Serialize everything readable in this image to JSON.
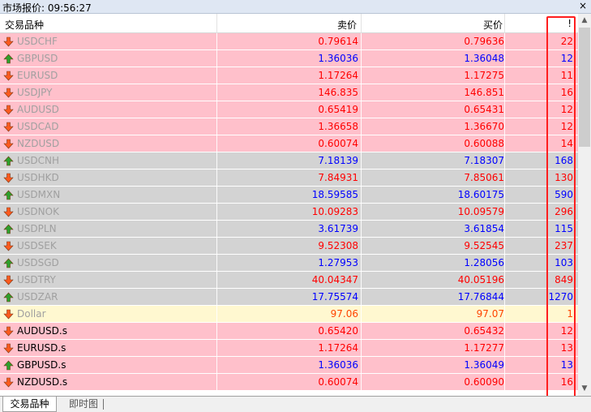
{
  "window": {
    "title": "市场报价: 09:56:27",
    "close_glyph": "×"
  },
  "header": {
    "symbol": "交易品种",
    "bid": "卖价",
    "ask": "买价",
    "spread": "!"
  },
  "rows": [
    {
      "symbol": "USDCHF",
      "bid": "0.79614",
      "ask": "0.79636",
      "spread": "22",
      "dir": "down",
      "bg": "pink",
      "sym_style": "dim",
      "price_color": "red",
      "spread_color": "red"
    },
    {
      "symbol": "GBPUSD",
      "bid": "1.36036",
      "ask": "1.36048",
      "spread": "12",
      "dir": "up",
      "bg": "pink",
      "sym_style": "dim",
      "price_color": "blue",
      "spread_color": "blue"
    },
    {
      "symbol": "EURUSD",
      "bid": "1.17264",
      "ask": "1.17275",
      "spread": "11",
      "dir": "down",
      "bg": "pink",
      "sym_style": "dim",
      "price_color": "red",
      "spread_color": "red"
    },
    {
      "symbol": "USDJPY",
      "bid": "146.835",
      "ask": "146.851",
      "spread": "16",
      "dir": "down",
      "bg": "pink",
      "sym_style": "dim",
      "price_color": "red",
      "spread_color": "red"
    },
    {
      "symbol": "AUDUSD",
      "bid": "0.65419",
      "ask": "0.65431",
      "spread": "12",
      "dir": "down",
      "bg": "pink",
      "sym_style": "dim",
      "price_color": "red",
      "spread_color": "red"
    },
    {
      "symbol": "USDCAD",
      "bid": "1.36658",
      "ask": "1.36670",
      "spread": "12",
      "dir": "down",
      "bg": "pink",
      "sym_style": "dim",
      "price_color": "red",
      "spread_color": "red"
    },
    {
      "symbol": "NZDUSD",
      "bid": "0.60074",
      "ask": "0.60088",
      "spread": "14",
      "dir": "down",
      "bg": "pink",
      "sym_style": "dim",
      "price_color": "red",
      "spread_color": "red"
    },
    {
      "symbol": "USDCNH",
      "bid": "7.18139",
      "ask": "7.18307",
      "spread": "168",
      "dir": "up",
      "bg": "gray",
      "sym_style": "dim",
      "price_color": "blue",
      "spread_color": "blue"
    },
    {
      "symbol": "USDHKD",
      "bid": "7.84931",
      "ask": "7.85061",
      "spread": "130",
      "dir": "down",
      "bg": "gray",
      "sym_style": "dim",
      "price_color": "red",
      "spread_color": "red"
    },
    {
      "symbol": "USDMXN",
      "bid": "18.59585",
      "ask": "18.60175",
      "spread": "590",
      "dir": "up",
      "bg": "gray",
      "sym_style": "dim",
      "price_color": "blue",
      "spread_color": "blue"
    },
    {
      "symbol": "USDNOK",
      "bid": "10.09283",
      "ask": "10.09579",
      "spread": "296",
      "dir": "down",
      "bg": "gray",
      "sym_style": "dim",
      "price_color": "red",
      "spread_color": "red"
    },
    {
      "symbol": "USDPLN",
      "bid": "3.61739",
      "ask": "3.61854",
      "spread": "115",
      "dir": "up",
      "bg": "gray",
      "sym_style": "dim",
      "price_color": "blue",
      "spread_color": "blue"
    },
    {
      "symbol": "USDSEK",
      "bid": "9.52308",
      "ask": "9.52545",
      "spread": "237",
      "dir": "down",
      "bg": "gray",
      "sym_style": "dim",
      "price_color": "red",
      "spread_color": "red"
    },
    {
      "symbol": "USDSGD",
      "bid": "1.27953",
      "ask": "1.28056",
      "spread": "103",
      "dir": "up",
      "bg": "gray",
      "sym_style": "dim",
      "price_color": "blue",
      "spread_color": "blue"
    },
    {
      "symbol": "USDTRY",
      "bid": "40.04347",
      "ask": "40.05196",
      "spread": "849",
      "dir": "down",
      "bg": "gray",
      "sym_style": "dim",
      "price_color": "red",
      "spread_color": "red"
    },
    {
      "symbol": "USDZAR",
      "bid": "17.75574",
      "ask": "17.76844",
      "spread": "1270",
      "dir": "up",
      "bg": "gray",
      "sym_style": "dim",
      "price_color": "blue",
      "spread_color": "blue"
    },
    {
      "symbol": "Dollar",
      "bid": "97.06",
      "ask": "97.07",
      "spread": "1",
      "dir": "down",
      "bg": "yellow",
      "sym_style": "dim",
      "price_color": "orange",
      "spread_color": "orange"
    },
    {
      "symbol": "AUDUSD.s",
      "bid": "0.65420",
      "ask": "0.65432",
      "spread": "12",
      "dir": "down",
      "bg": "pink",
      "sym_style": "blk",
      "price_color": "red",
      "spread_color": "red"
    },
    {
      "symbol": "EURUSD.s",
      "bid": "1.17264",
      "ask": "1.17277",
      "spread": "13",
      "dir": "down",
      "bg": "pink",
      "sym_style": "blk",
      "price_color": "red",
      "spread_color": "red"
    },
    {
      "symbol": "GBPUSD.s",
      "bid": "1.36036",
      "ask": "1.36049",
      "spread": "13",
      "dir": "up",
      "bg": "pink",
      "sym_style": "blk",
      "price_color": "blue",
      "spread_color": "blue"
    },
    {
      "symbol": "NZDUSD.s",
      "bid": "0.60074",
      "ask": "0.60090",
      "spread": "16",
      "dir": "down",
      "bg": "pink",
      "sym_style": "blk",
      "price_color": "red",
      "spread_color": "red"
    }
  ],
  "tabs": {
    "symbols": "交易品种",
    "tick_chart": "即时图"
  },
  "colors": {
    "up_arrow": "#2ca02c",
    "down_arrow": "#ff5a1e",
    "highlight_box": "#ff1e1e"
  }
}
